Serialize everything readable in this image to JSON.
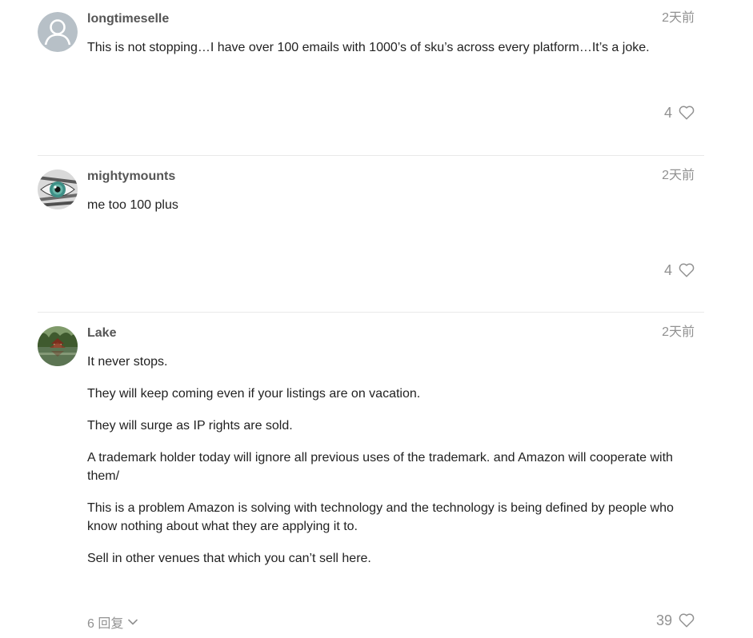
{
  "posts": [
    {
      "username": "longtimeselle",
      "date": "2天前",
      "paragraphs": [
        "This is not stopping…I have over 100 emails with 1000’s of sku’s across every platform…It’s a joke."
      ],
      "likes": "4"
    },
    {
      "username": "mightymounts",
      "date": "2天前",
      "paragraphs": [
        "me too 100 plus"
      ],
      "likes": "4"
    },
    {
      "username": "Lake",
      "date": "2天前",
      "paragraphs": [
        "It never stops.",
        "They will keep coming even if your listings are on vacation.",
        "They will surge as IP rights are sold.",
        "A trademark holder today will ignore all previous uses of the trademark. and Amazon will cooperate with them/",
        "This is a problem Amazon is solving with technology and the technology is being defined by people who know nothing about what they are applying it to.",
        "Sell in other venues that which you can’t sell here."
      ],
      "likes": "39",
      "replies_label": "6 回复"
    }
  ],
  "icons": {
    "like": "heart-icon",
    "expand": "chevron-down-icon",
    "default_avatar": "user-silhouette-icon"
  },
  "colors": {
    "muted_text": "#919191",
    "username": "#555555",
    "divider": "#e9e9e9",
    "default_avatar_bg": "#b7c0c7"
  }
}
